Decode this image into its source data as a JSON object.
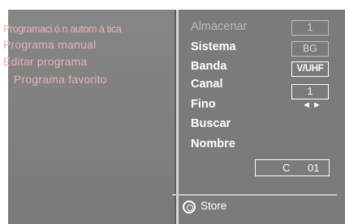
{
  "left_menu": {
    "items": [
      {
        "label": "Programaci ó n autom á tica"
      },
      {
        "label": "Programa manual"
      },
      {
        "label": "Editar programa"
      },
      {
        "label": "Programa favorito"
      }
    ]
  },
  "right_menu": {
    "almacenar": {
      "label": "Almacenar",
      "value": "1"
    },
    "sistema": {
      "label": "Sistema",
      "value": "BG"
    },
    "banda": {
      "label": "Banda",
      "value": "V/UHF"
    },
    "canal": {
      "label": "Canal",
      "value": "1"
    },
    "fino": {
      "label": "Fino",
      "arrows": "◄►"
    },
    "buscar": {
      "label": "Buscar"
    },
    "nombre": {
      "label": "Nombre"
    }
  },
  "channel_display": {
    "prefix": "C",
    "number": "01"
  },
  "footer": {
    "store_label": "Store",
    "store_icon": "ok-button-icon"
  },
  "colors": {
    "background": "#7b7b7b",
    "highlight_text": "#f0b2b2",
    "menu_text": "#e6b0b0",
    "label_text": "#ffffff",
    "dim_text": "#b9b9b9"
  }
}
